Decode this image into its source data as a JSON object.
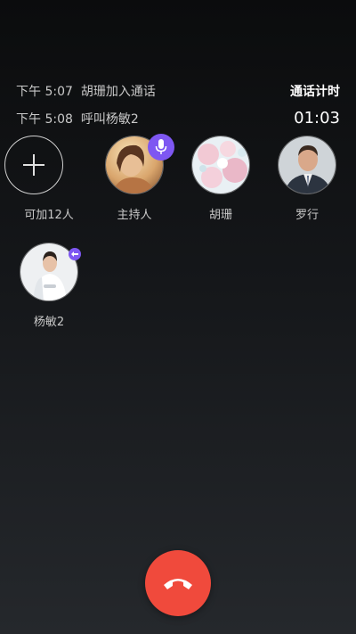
{
  "call_log": [
    {
      "time": "下午 5:07",
      "event": "胡珊加入通话"
    },
    {
      "time": "下午 5:08",
      "event": "呼叫杨敏2"
    }
  ],
  "timer": {
    "title": "通话计时",
    "value": "01:03"
  },
  "participants": {
    "add": {
      "label": "可加12人",
      "icon": "plus-icon"
    },
    "host": {
      "name": "主持人",
      "badge_icon": "microphone-icon"
    },
    "p1": {
      "name": "胡珊"
    },
    "p2": {
      "name": "罗行"
    },
    "p3": {
      "name": "杨敏2",
      "badge_icon": "calling-icon"
    }
  },
  "hangup": {
    "icon": "hang-up-phone-icon"
  },
  "colors": {
    "accent": "#7e57f2",
    "hangup": "#f04a3c",
    "text": "#c9c9c9"
  }
}
